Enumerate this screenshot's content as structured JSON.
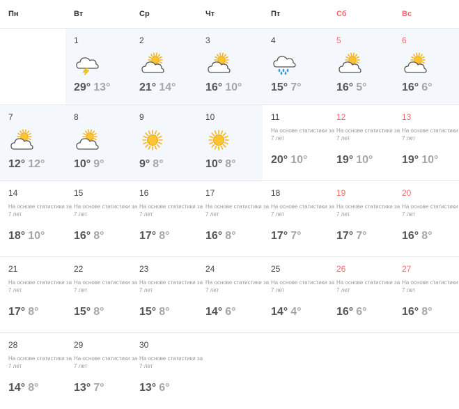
{
  "weekdays": [
    {
      "label": "Пн",
      "weekend": false
    },
    {
      "label": "Вт",
      "weekend": false
    },
    {
      "label": "Ср",
      "weekend": false
    },
    {
      "label": "Чт",
      "weekend": false
    },
    {
      "label": "Пт",
      "weekend": false
    },
    {
      "label": "Сб",
      "weekend": true
    },
    {
      "label": "Вс",
      "weekend": true
    }
  ],
  "statistics_note": "На основе статистики за 7 лет",
  "weeks": [
    [
      null,
      {
        "day": "1",
        "weekend": false,
        "forecast": true,
        "icon": "thunderstorm-icon",
        "hi": "29°",
        "lo": "13°"
      },
      {
        "day": "2",
        "weekend": false,
        "forecast": true,
        "icon": "partly-cloudy-icon",
        "hi": "21°",
        "lo": "14°"
      },
      {
        "day": "3",
        "weekend": false,
        "forecast": true,
        "icon": "partly-cloudy-icon",
        "hi": "16°",
        "lo": "10°"
      },
      {
        "day": "4",
        "weekend": false,
        "forecast": true,
        "icon": "rain-icon",
        "hi": "15°",
        "lo": "7°"
      },
      {
        "day": "5",
        "weekend": true,
        "forecast": true,
        "icon": "partly-cloudy-icon",
        "hi": "16°",
        "lo": "5°"
      },
      {
        "day": "6",
        "weekend": true,
        "forecast": true,
        "icon": "partly-cloudy-icon",
        "hi": "16°",
        "lo": "6°"
      }
    ],
    [
      {
        "day": "7",
        "weekend": false,
        "forecast": true,
        "icon": "partly-cloudy-icon",
        "hi": "12°",
        "lo": "12°"
      },
      {
        "day": "8",
        "weekend": false,
        "forecast": true,
        "icon": "partly-cloudy-icon",
        "hi": "10°",
        "lo": "9°"
      },
      {
        "day": "9",
        "weekend": false,
        "forecast": true,
        "icon": "sun-icon",
        "hi": "9°",
        "lo": "8°"
      },
      {
        "day": "10",
        "weekend": false,
        "forecast": true,
        "icon": "sun-icon",
        "hi": "10°",
        "lo": "8°"
      },
      {
        "day": "11",
        "weekend": false,
        "forecast": false,
        "hi": "20°",
        "lo": "10°"
      },
      {
        "day": "12",
        "weekend": true,
        "forecast": false,
        "hi": "19°",
        "lo": "10°"
      },
      {
        "day": "13",
        "weekend": true,
        "forecast": false,
        "hi": "19°",
        "lo": "10°"
      }
    ],
    [
      {
        "day": "14",
        "weekend": false,
        "forecast": false,
        "hi": "18°",
        "lo": "10°"
      },
      {
        "day": "15",
        "weekend": false,
        "forecast": false,
        "hi": "16°",
        "lo": "8°"
      },
      {
        "day": "16",
        "weekend": false,
        "forecast": false,
        "hi": "17°",
        "lo": "8°"
      },
      {
        "day": "17",
        "weekend": false,
        "forecast": false,
        "hi": "16°",
        "lo": "8°"
      },
      {
        "day": "18",
        "weekend": false,
        "forecast": false,
        "hi": "17°",
        "lo": "7°"
      },
      {
        "day": "19",
        "weekend": true,
        "forecast": false,
        "hi": "17°",
        "lo": "7°"
      },
      {
        "day": "20",
        "weekend": true,
        "forecast": false,
        "hi": "16°",
        "lo": "8°"
      }
    ],
    [
      {
        "day": "21",
        "weekend": false,
        "forecast": false,
        "hi": "17°",
        "lo": "8°"
      },
      {
        "day": "22",
        "weekend": false,
        "forecast": false,
        "hi": "15°",
        "lo": "8°"
      },
      {
        "day": "23",
        "weekend": false,
        "forecast": false,
        "hi": "15°",
        "lo": "8°"
      },
      {
        "day": "24",
        "weekend": false,
        "forecast": false,
        "hi": "14°",
        "lo": "6°"
      },
      {
        "day": "25",
        "weekend": false,
        "forecast": false,
        "hi": "14°",
        "lo": "4°"
      },
      {
        "day": "26",
        "weekend": true,
        "forecast": false,
        "hi": "16°",
        "lo": "6°"
      },
      {
        "day": "27",
        "weekend": true,
        "forecast": false,
        "hi": "16°",
        "lo": "8°"
      }
    ],
    [
      {
        "day": "28",
        "weekend": false,
        "forecast": false,
        "hi": "14°",
        "lo": "8°"
      },
      {
        "day": "29",
        "weekend": false,
        "forecast": false,
        "hi": "13°",
        "lo": "7°"
      },
      {
        "day": "30",
        "weekend": false,
        "forecast": false,
        "hi": "13°",
        "lo": "6°"
      },
      null,
      null,
      null,
      null
    ]
  ]
}
